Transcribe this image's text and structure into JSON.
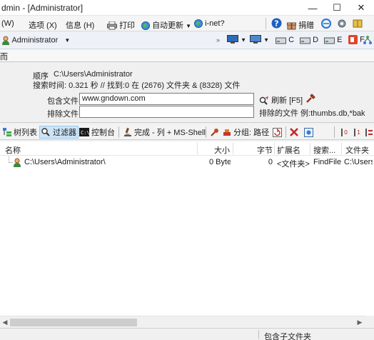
{
  "window": {
    "title": "dmin - [Administrator]",
    "min_glyph": "—",
    "max_glyph": "☐",
    "close_glyph": "✕"
  },
  "menu": {
    "w": "(W)",
    "options": "选项 (X)",
    "info": "信息 (H)",
    "print": "打印",
    "autoupdate": "自动更新",
    "inet": "i-net?",
    "donate": "捐赠"
  },
  "drives": {
    "user": "Administrator",
    "c": "C",
    "d": "D",
    "e": "E",
    "f": "F"
  },
  "tabs": {
    "left": "而"
  },
  "info": {
    "order_label": "顺序",
    "order_value": "C:\\Users\\Administrator",
    "search_summary": "搜索时间: 0.321 秒 //  找到:0 在 (2676) 文件夹 & (8328) 文件",
    "include_label": "包含文件",
    "include_value": "www.gndown.com",
    "refresh_label": "刷新 [F5]",
    "exclude_label": "排除文件",
    "exclude_value": "",
    "exclude_hint": "排除的文件 例:thumbs.db,*bak"
  },
  "toolbar": {
    "tree": "树列表",
    "filter": "过滤器",
    "console": "控制台",
    "complete": "完成 - 列 + MS-Shell",
    "group": "分组: 路径"
  },
  "list": {
    "headers": [
      "名称",
      "大小",
      "字节",
      "扩展名",
      "搜索...",
      "文件夹"
    ],
    "rows": [
      {
        "name": "C:\\Users\\Administrator\\",
        "size": "0 Byte",
        "bytes": "0",
        "ext": "<文件夹>",
        "search": "FindFile",
        "folder": "C:\\Users"
      }
    ]
  },
  "status": {
    "text": "包含子文件夹"
  },
  "colors": {
    "accent": "#1a73c8",
    "selected_bg": "#cce4f7",
    "red_icon": "#d02a20"
  }
}
